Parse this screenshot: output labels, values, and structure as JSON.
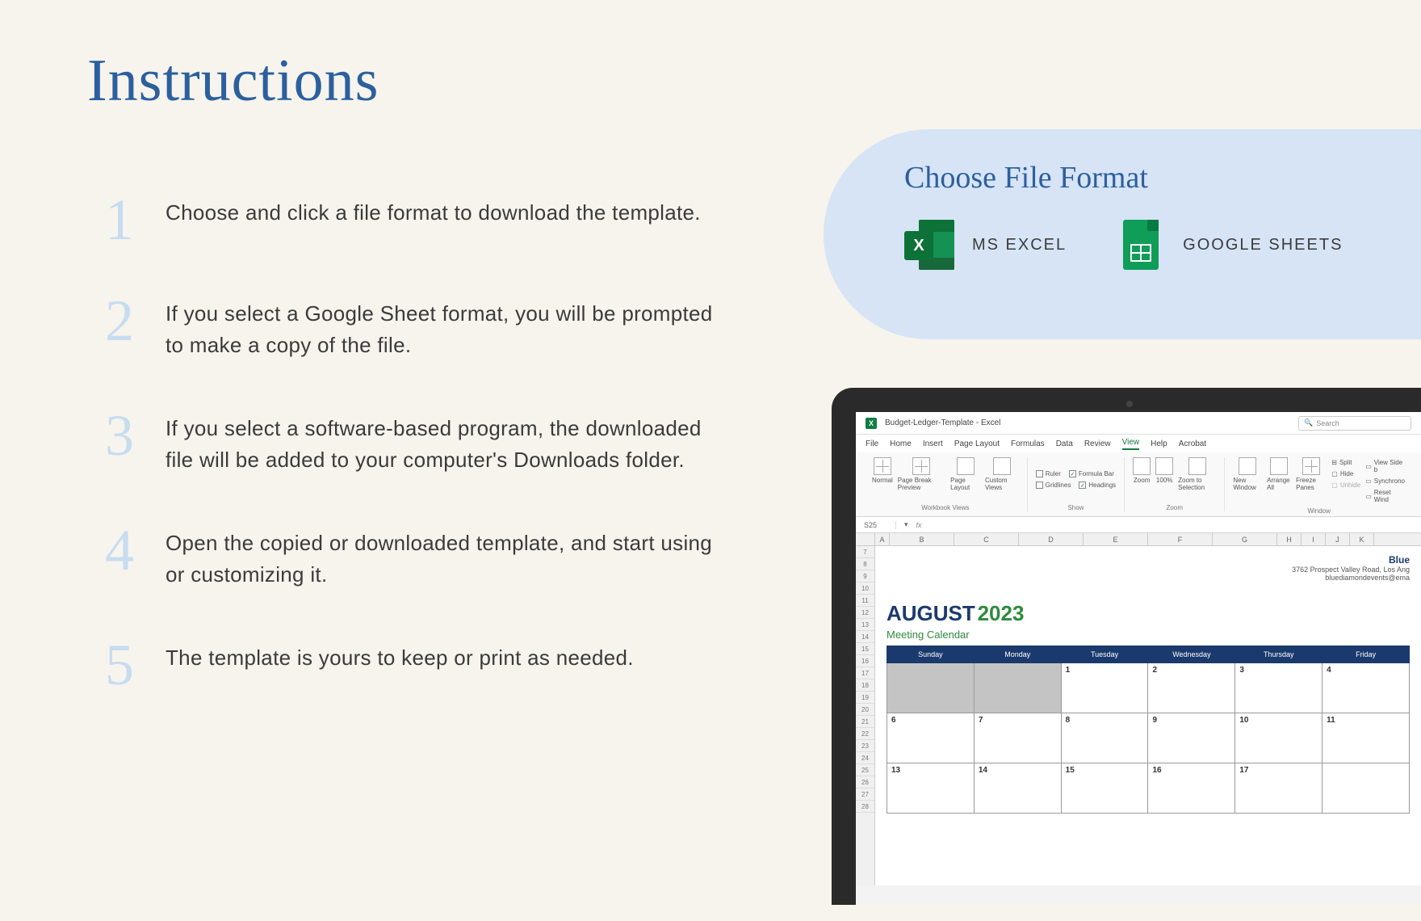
{
  "title": "Instructions",
  "steps": [
    {
      "num": "1",
      "text": "Choose and click a file format to download the template."
    },
    {
      "num": "2",
      "text": "If you select a Google Sheet format, you will be prompted to make a copy of the file."
    },
    {
      "num": "3",
      "text": "If you select a software-based program, the downloaded file will be added to your computer's Downloads folder."
    },
    {
      "num": "4",
      "text": "Open the copied or downloaded template, and start using or customizing it."
    },
    {
      "num": "5",
      "text": "The template is yours to keep or print as needed."
    }
  ],
  "panel": {
    "title": "Choose File Format",
    "options": [
      {
        "label": "MS EXCEL",
        "icon": "excel"
      },
      {
        "label": "GOOGLE SHEETS",
        "icon": "sheets"
      }
    ]
  },
  "laptop": {
    "titlebar": "Budget-Ledger-Template  -  Excel",
    "search": "Search",
    "menus": [
      "File",
      "Home",
      "Insert",
      "Page Layout",
      "Formulas",
      "Data",
      "Review",
      "View",
      "Help",
      "Acrobat"
    ],
    "active_menu": "View",
    "ribbon": {
      "groups": [
        "Workbook Views",
        "Show",
        "Zoom",
        "Window"
      ],
      "views": [
        "Normal",
        "Page Break Preview",
        "Page Layout",
        "Custom Views"
      ],
      "show": [
        "Ruler",
        "Formula Bar",
        "Gridlines",
        "Headings"
      ],
      "zoom": [
        "Zoom",
        "100%",
        "Zoom to Selection"
      ],
      "window": [
        "New Window",
        "Arrange All",
        "Freeze Panes"
      ],
      "window2": [
        "Split",
        "Hide",
        "Unhide"
      ],
      "window3": [
        "View Side b",
        "Synchrono",
        "Reset Wind"
      ]
    },
    "cell": "S25",
    "fx": "fx",
    "cols": [
      "A",
      "B",
      "C",
      "D",
      "E",
      "F",
      "G",
      "H",
      "I",
      "J",
      "K"
    ],
    "rows": [
      "7",
      "8",
      "9",
      "10",
      "11",
      "12",
      "13",
      "14",
      "15",
      "16",
      "17",
      "18",
      "19",
      "20",
      "21",
      "22",
      "23",
      "24",
      "25",
      "26",
      "27",
      "28"
    ],
    "company": {
      "name": "Blue",
      "addr": "3762 Prospect Valley Road, Los Ang",
      "email": "bluediamondevents@ema"
    },
    "month": "AUGUST",
    "year": "2023",
    "sub": "Meeting Calendar",
    "days": [
      "Sunday",
      "Monday",
      "Tuesday",
      "Wednesday",
      "Thursday",
      "Friday"
    ],
    "cal": [
      [
        {
          "v": "",
          "g": true
        },
        {
          "v": "",
          "g": true
        },
        {
          "v": "1"
        },
        {
          "v": "2"
        },
        {
          "v": "3"
        },
        {
          "v": "4"
        }
      ],
      [
        {
          "v": "6"
        },
        {
          "v": "7"
        },
        {
          "v": "8"
        },
        {
          "v": "9"
        },
        {
          "v": "10"
        },
        {
          "v": "11"
        }
      ],
      [
        {
          "v": "13"
        },
        {
          "v": "14"
        },
        {
          "v": "15"
        },
        {
          "v": "16"
        },
        {
          "v": "17"
        },
        {
          "v": ""
        }
      ]
    ]
  }
}
